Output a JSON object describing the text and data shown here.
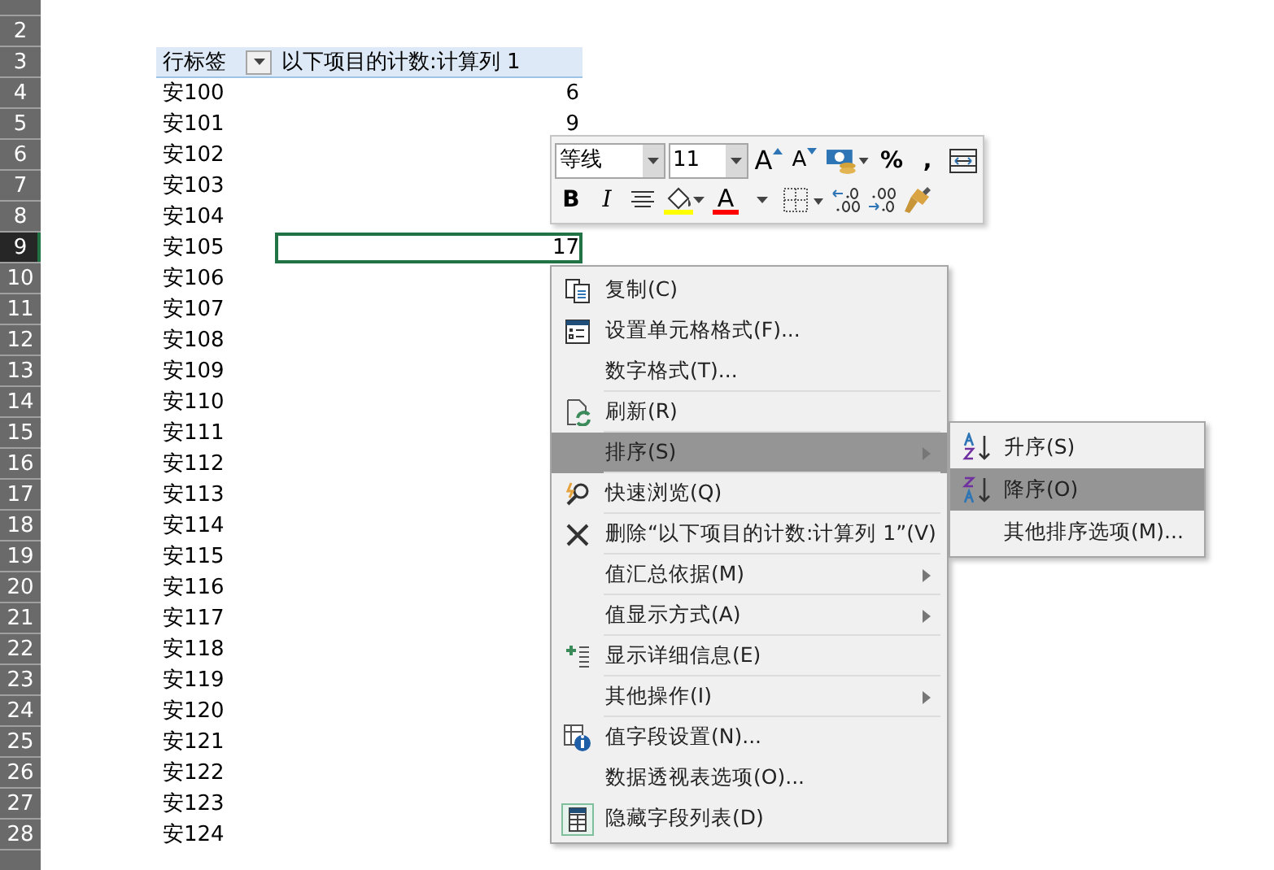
{
  "sheet": {
    "rows": [
      {
        "kind": "blank",
        "selected": false
      },
      {
        "number": "2",
        "kind": "blank",
        "selected": false
      },
      {
        "number": "3",
        "kind": "header",
        "selected": false,
        "row_label": "行标签",
        "value_label": "以下项目的计数:计算列 1"
      },
      {
        "number": "4",
        "kind": "item",
        "selected": false,
        "label": "安100",
        "value": "6"
      },
      {
        "number": "5",
        "kind": "item",
        "selected": false,
        "label": "安101",
        "value": "9"
      },
      {
        "number": "6",
        "kind": "item",
        "selected": false,
        "label": "安102"
      },
      {
        "number": "7",
        "kind": "item",
        "selected": false,
        "label": "安103"
      },
      {
        "number": "8",
        "kind": "item",
        "selected": false,
        "label": "安104"
      },
      {
        "number": "9",
        "kind": "item",
        "selected": true,
        "label": "安105",
        "value": "17"
      },
      {
        "number": "10",
        "kind": "item",
        "selected": false,
        "label": "安106"
      },
      {
        "number": "11",
        "kind": "item",
        "selected": false,
        "label": "安107"
      },
      {
        "number": "12",
        "kind": "item",
        "selected": false,
        "label": "安108"
      },
      {
        "number": "13",
        "kind": "item",
        "selected": false,
        "label": "安109"
      },
      {
        "number": "14",
        "kind": "item",
        "selected": false,
        "label": "安110"
      },
      {
        "number": "15",
        "kind": "item",
        "selected": false,
        "label": "安111"
      },
      {
        "number": "16",
        "kind": "item",
        "selected": false,
        "label": "安112"
      },
      {
        "number": "17",
        "kind": "item",
        "selected": false,
        "label": "安113"
      },
      {
        "number": "18",
        "kind": "item",
        "selected": false,
        "label": "安114"
      },
      {
        "number": "19",
        "kind": "item",
        "selected": false,
        "label": "安115"
      },
      {
        "number": "20",
        "kind": "item",
        "selected": false,
        "label": "安116"
      },
      {
        "number": "21",
        "kind": "item",
        "selected": false,
        "label": "安117"
      },
      {
        "number": "22",
        "kind": "item",
        "selected": false,
        "label": "安118"
      },
      {
        "number": "23",
        "kind": "item",
        "selected": false,
        "label": "安119"
      },
      {
        "number": "24",
        "kind": "item",
        "selected": false,
        "label": "安120"
      },
      {
        "number": "25",
        "kind": "item",
        "selected": false,
        "label": "安121"
      },
      {
        "number": "26",
        "kind": "item",
        "selected": false,
        "label": "安122"
      },
      {
        "number": "27",
        "kind": "item",
        "selected": false,
        "label": "安123"
      },
      {
        "number": "28",
        "kind": "item",
        "selected": false,
        "label": "安124"
      },
      {
        "kind": "blank",
        "selected": false
      }
    ]
  },
  "mini_toolbar": {
    "rows": [
      [
        {
          "kind": "font-select",
          "value": "等线"
        },
        {
          "kind": "size-select",
          "value": "11"
        },
        {
          "kind": "grow-font",
          "glyph": "A"
        },
        {
          "kind": "shrink-font",
          "glyph": "A"
        },
        {
          "kind": "accounting"
        },
        {
          "kind": "text",
          "glyph": "%"
        },
        {
          "kind": "text",
          "glyph": ","
        },
        {
          "kind": "wrap"
        }
      ],
      [
        {
          "kind": "bold",
          "glyph": "B"
        },
        {
          "kind": "italic",
          "glyph": "I"
        },
        {
          "kind": "align"
        },
        {
          "kind": "fill-color",
          "color": "#ffff00"
        },
        {
          "kind": "font-color",
          "glyph": "A",
          "color": "#ff0000"
        },
        {
          "kind": "borders"
        },
        {
          "kind": "inc-decimal"
        },
        {
          "kind": "dec-decimal"
        },
        {
          "kind": "painter"
        }
      ]
    ]
  },
  "context_menu": {
    "items": [
      {
        "label": "复制(C)",
        "kind": "copy",
        "submenu": false,
        "selected": false,
        "separated": false
      },
      {
        "label": "设置单元格格式(F)...",
        "kind": "format",
        "submenu": false,
        "selected": false,
        "separated": false
      },
      {
        "label": "数字格式(T)...",
        "submenu": false,
        "selected": false,
        "separated": true
      },
      {
        "label": "刷新(R)",
        "kind": "refresh",
        "submenu": false,
        "selected": false,
        "separated": true
      },
      {
        "label": "排序(S)",
        "submenu": true,
        "selected": true,
        "separated": true
      },
      {
        "label": "快速浏览(Q)",
        "kind": "explore",
        "submenu": false,
        "selected": false,
        "separated": true
      },
      {
        "label": "删除“以下项目的计数:计算列 1”(V)",
        "kind": "delete",
        "submenu": false,
        "selected": false,
        "separated": true
      },
      {
        "label": "值汇总依据(M)",
        "submenu": true,
        "selected": false,
        "separated": true
      },
      {
        "label": "值显示方式(A)",
        "submenu": true,
        "selected": false,
        "separated": true
      },
      {
        "label": "显示详细信息(E)",
        "kind": "details",
        "submenu": false,
        "selected": false,
        "separated": true
      },
      {
        "label": "其他操作(I)",
        "submenu": true,
        "selected": false,
        "separated": true
      },
      {
        "label": "值字段设置(N)...",
        "kind": "field-info",
        "submenu": false,
        "selected": false,
        "separated": false
      },
      {
        "label": "数据透视表选项(O)...",
        "submenu": false,
        "selected": false,
        "separated": false
      },
      {
        "label": "隐藏字段列表(D)",
        "kind": "field-list",
        "submenu": false,
        "selected": false,
        "separated": false
      }
    ]
  },
  "sort_submenu": {
    "items": [
      {
        "label": "升序(S)",
        "kind": "sort-asc",
        "selected": false
      },
      {
        "label": "降序(O)",
        "kind": "sort-desc",
        "selected": true
      },
      {
        "label": "其他排序选项(M)...",
        "selected": false
      }
    ]
  }
}
